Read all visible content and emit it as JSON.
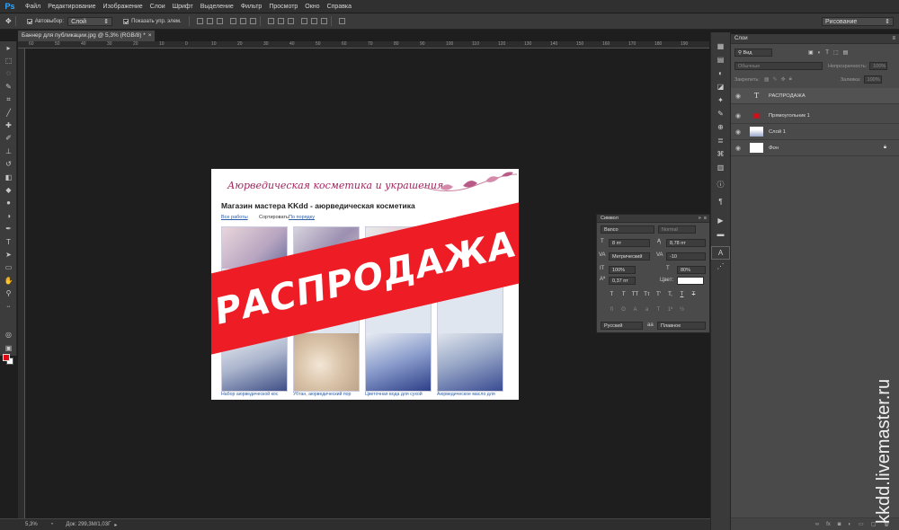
{
  "app": {
    "logo": "Ps"
  },
  "menu": [
    "Файл",
    "Редактирование",
    "Изображение",
    "Слои",
    "Шрифт",
    "Выделение",
    "Фильтр",
    "Просмотр",
    "Окно",
    "Справка"
  ],
  "options": {
    "autoselect_label": "Автовыбор:",
    "autoselect_value": "Слой",
    "show_controls_label": "Показать упр. элем.",
    "workspace": "Рисование"
  },
  "document": {
    "tab_title": "Баннер для публикации.jpg @ 5,3% (RGB/8) *",
    "ruler_ticks": [
      "60",
      "50",
      "40",
      "30",
      "20",
      "10",
      "0",
      "10",
      "20",
      "30",
      "40",
      "50",
      "60",
      "70",
      "80",
      "90",
      "100",
      "110",
      "120",
      "130",
      "140",
      "150",
      "160",
      "170",
      "180",
      "190"
    ]
  },
  "canvas": {
    "banner_title": "Аюрведическая косметика и украшения",
    "shop_title": "Магазин мастера KKdd - аюрведическая косметика",
    "link_all": "Все работы",
    "sort_label": "Сортировать:",
    "sort_link": "По порядку",
    "sale_text": "РАСПРОДАЖА",
    "captions": [
      "Набор аюрведической кос",
      "Убтан, аюрведический пор",
      "Цветочная вода для сухой",
      "Аюрведическое масло для"
    ]
  },
  "character_panel": {
    "title": "Символ",
    "font_family": "Banco",
    "font_style": "Normal",
    "size": "8 пт",
    "leading": "8,78 пт",
    "kerning": "Метрический",
    "tracking": "-10",
    "vertical_scale": "100%",
    "horizontal_scale": "80%",
    "baseline": "0,37 пт",
    "color_label": "Цвет:",
    "style_buttons": [
      "T",
      "T",
      "TT",
      "Tт",
      "T'",
      "T,",
      "T",
      "T"
    ],
    "language": "Русский",
    "aa_label": "aa",
    "antialias": "Плавное"
  },
  "layers_panel": {
    "tab": "Слои",
    "filter": "Вид",
    "blend_mode": "Обычные",
    "opacity_label": "Непрозрачность:",
    "opacity": "100%",
    "lock_label": "Закрепить:",
    "fill_label": "Заливка:",
    "fill": "100%",
    "layers": [
      {
        "name": "РАСПРОДАЖА",
        "kind": "text"
      },
      {
        "name": "Прямоугольник 1",
        "kind": "shape"
      },
      {
        "name": "Слой 1",
        "kind": "image"
      },
      {
        "name": "Фон",
        "kind": "background"
      }
    ]
  },
  "watermark": "kkdd.livemaster.ru",
  "status": {
    "zoom": "5,3%",
    "doc_size": "Док: 299,3M/1,03Г"
  },
  "colors": {
    "foreground": "#e30613",
    "background": "#ffffff",
    "sale_red": "#ee1c25",
    "title_purple": "#a0245d"
  }
}
